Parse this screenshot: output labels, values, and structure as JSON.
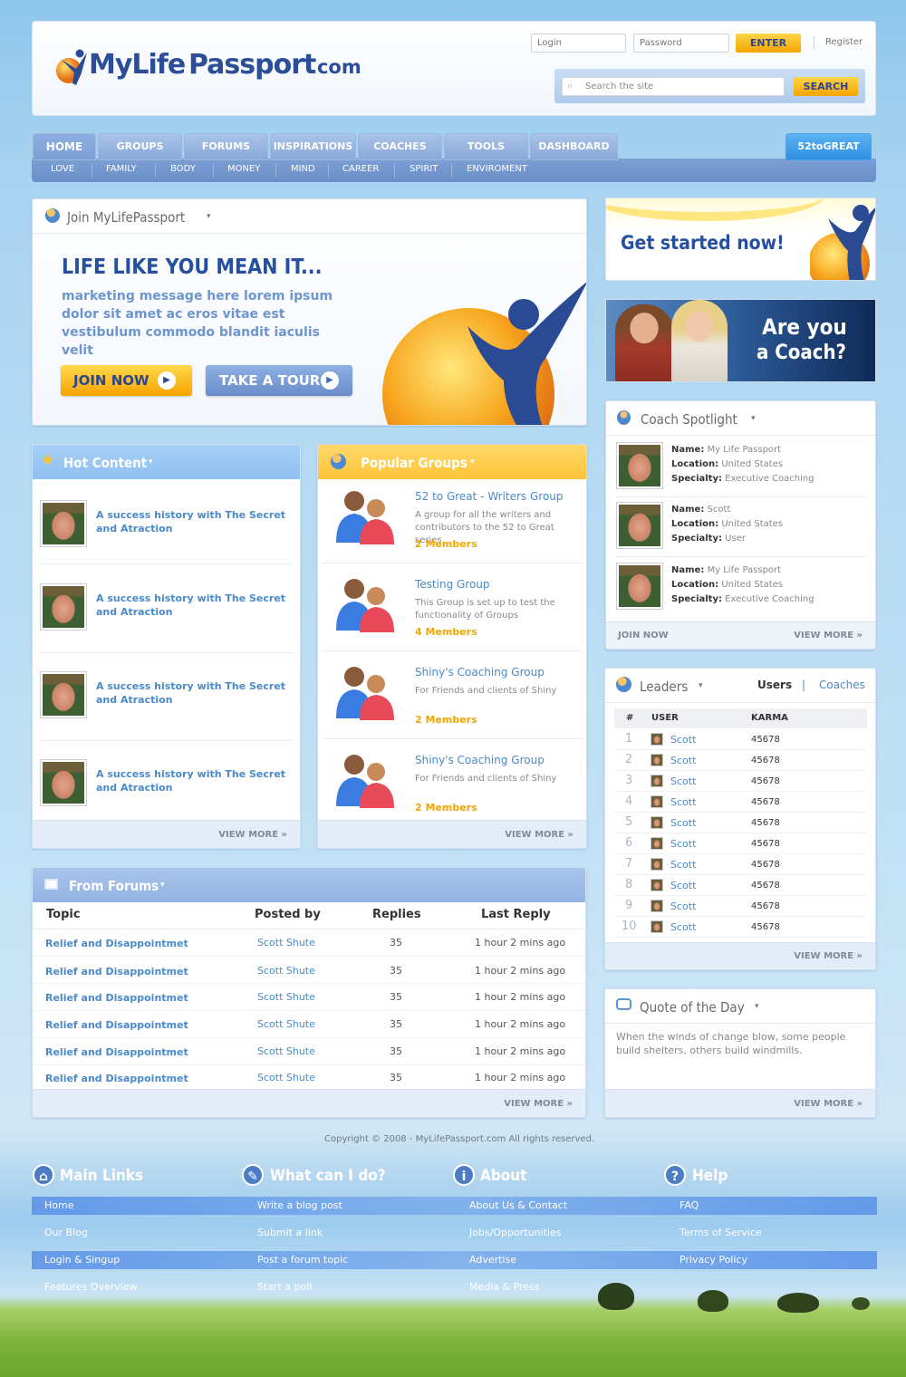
{
  "header": {
    "logo": {
      "my": "MyLife",
      "passport": "Passport",
      ".com": ".com"
    },
    "login_placeholder": "Login",
    "password_placeholder": "Password",
    "enter_label": "ENTER",
    "register_label": "Register",
    "search_placeholder": "Search the site",
    "search_label": "SEARCH"
  },
  "nav": {
    "tabs": [
      "HOME",
      "GROUPS",
      "FORUMS",
      "INSPIRATIONS",
      "COACHES",
      "TOOLS",
      "DASHBOARD"
    ],
    "special": "52toGREAT",
    "sub": [
      "LOVE",
      "FAMILY",
      "BODY",
      "MONEY",
      "MIND",
      "CAREER",
      "SPIRIT",
      "ENVIROMENT"
    ]
  },
  "join": {
    "title": "Join MyLifePassport",
    "headline": "LIFE LIKE YOU MEAN IT...",
    "message": "marketing message here lorem ipsum dolor sit amet ac eros vitae est vestibulum commodo blandit iaculis velit",
    "join_btn": "JOIN NOW",
    "tour_btn": "TAKE A TOUR"
  },
  "promo": {
    "get_started": "Get started now!",
    "coach_line1": "Are you",
    "coach_line2": "a Coach?"
  },
  "hot": {
    "title": "Hot Content",
    "items": [
      "A success history with The Secret and Atraction",
      "A success history with The Secret and Atraction",
      "A success history with The Secret and Atraction",
      "A success history with The Secret and Atraction"
    ],
    "view_more": "VIEW MORE »"
  },
  "groups": {
    "title": "Popular Groups",
    "items": [
      {
        "name": "52 to Great - Writers Group",
        "desc": "A group for all the writers and contributors to the 52 to Great series",
        "members": "2 Members"
      },
      {
        "name": "Testing Group",
        "desc": "This Group is set up to test the functionality of Groups",
        "members": "4 Members"
      },
      {
        "name": "Shiny's Coaching Group",
        "desc": "For Friends and clients of Shiny",
        "members": "2 Members"
      },
      {
        "name": "Shiny's Coaching Group",
        "desc": "For Friends and clients of Shiny",
        "members": "2 Members"
      }
    ],
    "view_more": "VIEW MORE »"
  },
  "coach": {
    "title": "Coach Spotlight",
    "labels": {
      "name": "Name:",
      "location": "Location:",
      "specialty": "Specialty:"
    },
    "items": [
      {
        "name": "My Life Passport",
        "location": "United States",
        "specialty": "Executive Coaching"
      },
      {
        "name": "Scott",
        "location": "United States",
        "specialty": "User"
      },
      {
        "name": "My Life Passport",
        "location": "United States",
        "specialty": "Executive Coaching"
      }
    ],
    "join_now": "JOIN NOW",
    "view_more": "VIEW MORE »"
  },
  "leaders": {
    "title": "Leaders",
    "tab_users": "Users",
    "sep": "|",
    "tab_coaches": "Coaches",
    "col_num": "#",
    "col_user": "USER",
    "col_karma": "KARMA",
    "rows": [
      {
        "n": "1",
        "u": "Scott",
        "k": "45678"
      },
      {
        "n": "2",
        "u": "Scott",
        "k": "45678"
      },
      {
        "n": "3",
        "u": "Scott",
        "k": "45678"
      },
      {
        "n": "4",
        "u": "Scott",
        "k": "45678"
      },
      {
        "n": "5",
        "u": "Scott",
        "k": "45678"
      },
      {
        "n": "6",
        "u": "Scott",
        "k": "45678"
      },
      {
        "n": "7",
        "u": "Scott",
        "k": "45678"
      },
      {
        "n": "8",
        "u": "Scott",
        "k": "45678"
      },
      {
        "n": "9",
        "u": "Scott",
        "k": "45678"
      },
      {
        "n": "10",
        "u": "Scott",
        "k": "45678"
      }
    ],
    "view_more": "VIEW MORE »"
  },
  "forums": {
    "title": "From Forums",
    "cols": [
      "Topic",
      "Posted by",
      "Replies",
      "Last Reply"
    ],
    "rows": [
      {
        "t": "Relief and Disappointmet",
        "p": "Scott Shute",
        "r": "35",
        "l": "1 hour 2 mins ago"
      },
      {
        "t": "Relief and Disappointmet",
        "p": "Scott Shute",
        "r": "35",
        "l": "1 hour 2 mins ago"
      },
      {
        "t": "Relief and Disappointmet",
        "p": "Scott Shute",
        "r": "35",
        "l": "1 hour 2 mins ago"
      },
      {
        "t": "Relief and Disappointmet",
        "p": "Scott Shute",
        "r": "35",
        "l": "1 hour 2 mins ago"
      },
      {
        "t": "Relief and Disappointmet",
        "p": "Scott Shute",
        "r": "35",
        "l": "1 hour 2 mins ago"
      },
      {
        "t": "Relief and Disappointmet",
        "p": "Scott Shute",
        "r": "35",
        "l": "1 hour 2 mins ago"
      }
    ],
    "view_more": "VIEW MORE »"
  },
  "quote": {
    "title": "Quote of the Day",
    "text": "When the winds of change blow, some people build shelters, others build windmills.",
    "view_more": "VIEW MORE »"
  },
  "copyright": "Copyright ©  2008 - MyLifePassport.com All rights reserved.",
  "footer": {
    "cols": [
      {
        "title": "Main Links",
        "links": [
          "Home",
          "Our Blog",
          "Login & Singup",
          "Features Overview"
        ]
      },
      {
        "title": "What can I do?",
        "links": [
          "Write a blog post",
          "Submit a link",
          "Post a forum topic",
          "Start a poll"
        ]
      },
      {
        "title": "About",
        "links": [
          "About Us & Contact",
          "Jobs/Opportunities",
          "Advertise",
          "Media & Press"
        ]
      },
      {
        "title": "Help",
        "links": [
          "FAQ",
          "Terms of Service",
          "Privacy Policy"
        ]
      }
    ]
  }
}
